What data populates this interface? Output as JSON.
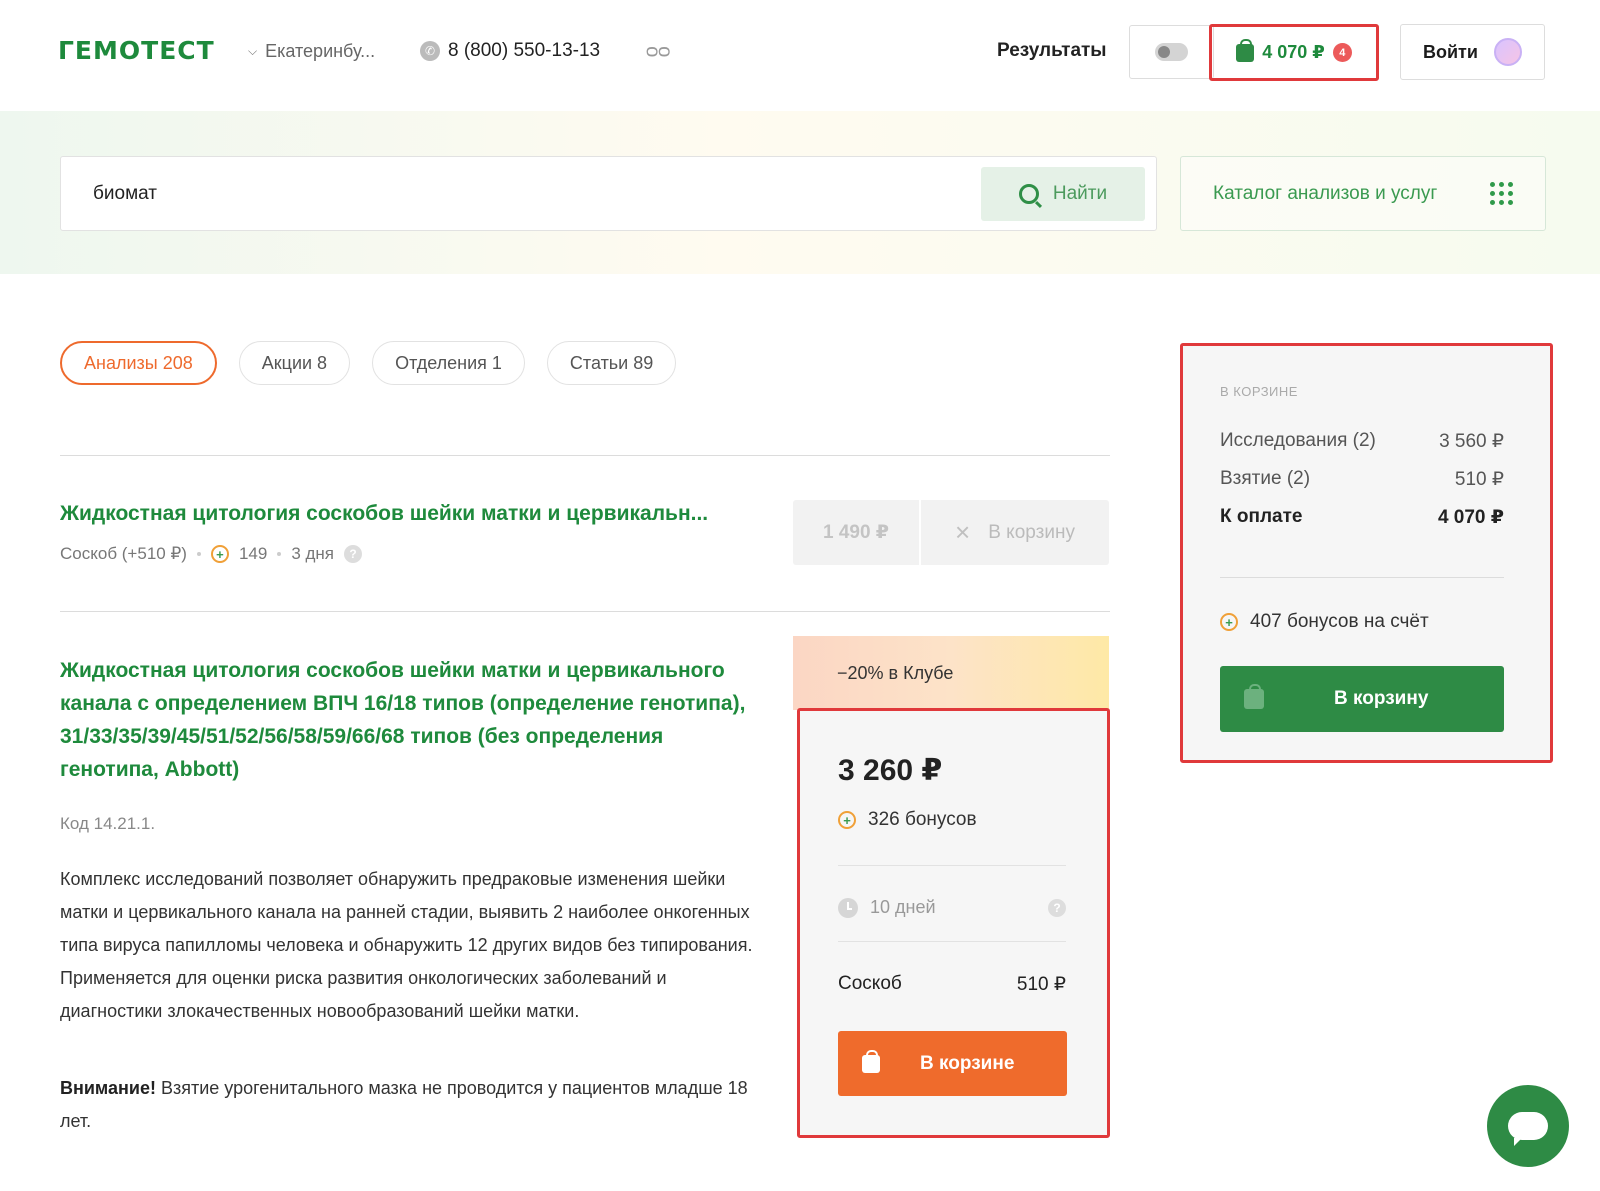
{
  "header": {
    "logo": "ГЕМОТЕСТ",
    "city": "Екатеринбу...",
    "phone": "8 (800) 550-13-13",
    "results_label": "Результаты",
    "cart_total": "4 070 ₽",
    "cart_count": "4",
    "login_label": "Войти"
  },
  "search": {
    "query": "биомат",
    "button_label": "Найти",
    "catalog_label": "Каталог анализов и услуг"
  },
  "tabs": [
    {
      "label": "Анализы 208",
      "active": true
    },
    {
      "label": "Акции 8",
      "active": false
    },
    {
      "label": "Отделения 1",
      "active": false
    },
    {
      "label": "Статьи 89",
      "active": false
    }
  ],
  "item1": {
    "title": "Жидкостная цитология соскобов шейки матки и цервикальн...",
    "sample": "Соскоб (+510 ₽)",
    "bonus": "149",
    "duration": "3 дня",
    "price": "1 490 ₽",
    "cart_label": "В корзину"
  },
  "item2": {
    "title": "Жидкостная цитология соскобов шейки матки и цервикального канала с определением ВПЧ 16/18 типов (определение генотипа), 31/33/35/39/45/51/52/56/58/59/66/68 типов (без определения генотипа, Abbott)",
    "code": "Код 14.21.1.",
    "description": "Комплекс исследований позволяет обнаружить предраковые изменения шейки матки и цервикального канала на ранней стадии, выявить 2 наиболее онкогенных типа вируса папилломы человека и обнаружить 12 других видов без типирования. Применяется для оценки риска развития онкологических заболеваний и диагностики злокачественных новообразований шейки матки.",
    "warning_bold": "Внимание!",
    "warning_text": " Взятие урогенитального мазка не проводится у пациентов младше 18 лет.",
    "club_discount": "−20% в Клубе",
    "price": "3 260 ₽",
    "bonus": "326 бонусов",
    "duration": "10 дней",
    "sample_label": "Соскоб",
    "sample_price": "510 ₽",
    "button_label": "В корзине"
  },
  "summary": {
    "heading": "В КОРЗИНЕ",
    "rows": [
      {
        "label": "Исследования (2)",
        "value": "3 560 ₽"
      },
      {
        "label": "Взятие (2)",
        "value": "510 ₽"
      },
      {
        "label": "К оплате",
        "value": "4 070 ₽"
      }
    ],
    "bonus": "407 бонусов на счёт",
    "button_label": "В корзину"
  },
  "colors": {
    "brand_green": "#1e8a3c",
    "accent_orange": "#ef6b2c",
    "highlight_red": "#e0393b"
  }
}
